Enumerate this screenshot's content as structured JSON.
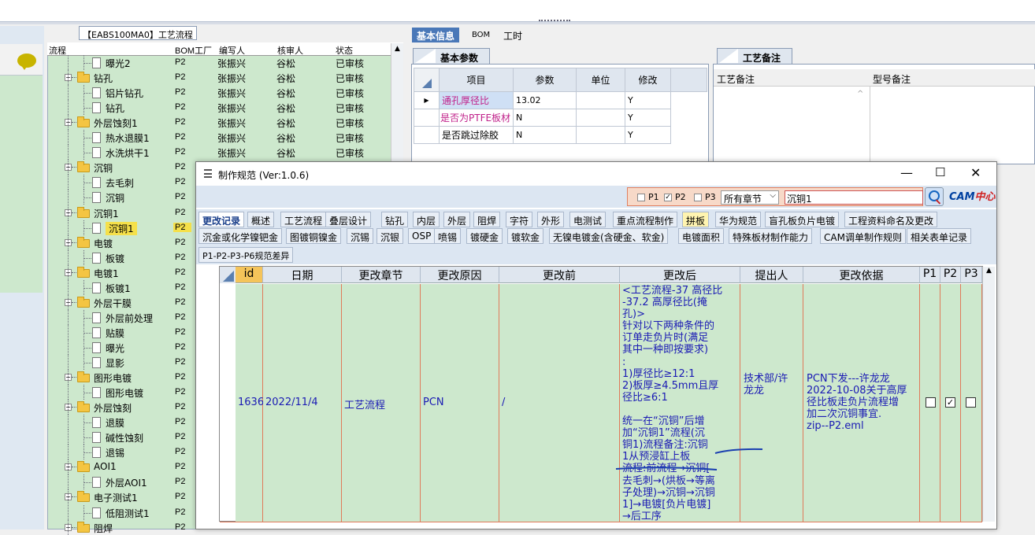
{
  "colors": {
    "green_row": "#cde8cd",
    "selected": "#f5e04a",
    "tab_active": "#4a78b8",
    "annotation": "#1a1ab4"
  },
  "tree_panel": {
    "tab_title": "【EABS100MA0】工艺流程",
    "headers": [
      "流程",
      "BOM工厂",
      "编写人",
      "核审人",
      "状态"
    ],
    "rows": [
      {
        "name": "曝光2",
        "level": 2,
        "factory": "P2",
        "writer": "张振兴",
        "checker": "谷松",
        "status": "已审核"
      },
      {
        "name": "钻孔",
        "level": 1,
        "factory": "P2",
        "writer": "张振兴",
        "checker": "谷松",
        "status": "已审核"
      },
      {
        "name": "铝片钻孔",
        "level": 2,
        "factory": "P2",
        "writer": "张振兴",
        "checker": "谷松",
        "status": "已审核"
      },
      {
        "name": "钻孔",
        "level": 2,
        "factory": "P2",
        "writer": "张振兴",
        "checker": "谷松",
        "status": "已审核"
      },
      {
        "name": "外层蚀刻1",
        "level": 1,
        "factory": "P2",
        "writer": "张振兴",
        "checker": "谷松",
        "status": "已审核"
      },
      {
        "name": "热水退膜1",
        "level": 2,
        "factory": "P2",
        "writer": "张振兴",
        "checker": "谷松",
        "status": "已审核"
      },
      {
        "name": "水洗烘干1",
        "level": 2,
        "factory": "P2",
        "writer": "张振兴",
        "checker": "谷松",
        "status": "已审核"
      },
      {
        "name": "沉铜",
        "level": 1,
        "factory": "P2",
        "writer": "",
        "checker": "",
        "status": ""
      },
      {
        "name": "去毛刺",
        "level": 2,
        "factory": "P2",
        "writer": "",
        "checker": "",
        "status": ""
      },
      {
        "name": "沉铜",
        "level": 2,
        "factory": "P2",
        "writer": "",
        "checker": "",
        "status": ""
      },
      {
        "name": "沉铜1",
        "level": 1,
        "factory": "P2",
        "writer": "",
        "checker": "",
        "status": ""
      },
      {
        "name": "沉铜1",
        "level": 2,
        "factory": "P2",
        "writer": "",
        "checker": "",
        "status": "",
        "selected": true
      },
      {
        "name": "电镀",
        "level": 1,
        "factory": "P2",
        "writer": "",
        "checker": "",
        "status": ""
      },
      {
        "name": "板镀",
        "level": 2,
        "factory": "P2",
        "writer": "",
        "checker": "",
        "status": ""
      },
      {
        "name": "电镀1",
        "level": 1,
        "factory": "P2",
        "writer": "",
        "checker": "",
        "status": ""
      },
      {
        "name": "板镀1",
        "level": 2,
        "factory": "P2",
        "writer": "",
        "checker": "",
        "status": ""
      },
      {
        "name": "外层干膜",
        "level": 1,
        "factory": "P2",
        "writer": "",
        "checker": "",
        "status": ""
      },
      {
        "name": "外层前处理",
        "level": 2,
        "factory": "P2",
        "writer": "",
        "checker": "",
        "status": ""
      },
      {
        "name": "贴膜",
        "level": 2,
        "factory": "P2",
        "writer": "",
        "checker": "",
        "status": ""
      },
      {
        "name": "曝光",
        "level": 2,
        "factory": "P2",
        "writer": "",
        "checker": "",
        "status": ""
      },
      {
        "name": "显影",
        "level": 2,
        "factory": "P2",
        "writer": "",
        "checker": "",
        "status": ""
      },
      {
        "name": "图形电镀",
        "level": 1,
        "factory": "P2",
        "writer": "",
        "checker": "",
        "status": ""
      },
      {
        "name": "图形电镀",
        "level": 2,
        "factory": "P2",
        "writer": "",
        "checker": "",
        "status": ""
      },
      {
        "name": "外层蚀刻",
        "level": 1,
        "factory": "P2",
        "writer": "",
        "checker": "",
        "status": ""
      },
      {
        "name": "退膜",
        "level": 2,
        "factory": "P2",
        "writer": "",
        "checker": "",
        "status": ""
      },
      {
        "name": "碱性蚀刻",
        "level": 2,
        "factory": "P2",
        "writer": "",
        "checker": "",
        "status": ""
      },
      {
        "name": "退锡",
        "level": 2,
        "factory": "P2",
        "writer": "",
        "checker": "",
        "status": ""
      },
      {
        "name": "AOI1",
        "level": 1,
        "factory": "P2",
        "writer": "",
        "checker": "",
        "status": ""
      },
      {
        "name": "外层AOI1",
        "level": 2,
        "factory": "P2",
        "writer": "",
        "checker": "",
        "status": ""
      },
      {
        "name": "电子测试1",
        "level": 1,
        "factory": "P2",
        "writer": "",
        "checker": "",
        "status": ""
      },
      {
        "name": "低阻测试1",
        "level": 2,
        "factory": "P2",
        "writer": "",
        "checker": "",
        "status": ""
      },
      {
        "name": "阻焊",
        "level": 1,
        "factory": "P2",
        "writer": "",
        "checker": "",
        "status": ""
      }
    ]
  },
  "right_tabs": [
    "基本信息",
    "BOM",
    "工时"
  ],
  "basic": {
    "sub_tab": "基本参数",
    "headers": [
      "项目",
      "参数",
      "单位",
      "修改"
    ],
    "rows": [
      {
        "item": "通孔厚径比",
        "param": "13.02",
        "unit": "",
        "edit": "Y"
      },
      {
        "item": "是否为PTFE板材",
        "param": "N",
        "unit": "",
        "edit": "Y"
      },
      {
        "item": "是否跳过除胶",
        "param": "N",
        "unit": "",
        "edit": "Y"
      }
    ]
  },
  "notes": {
    "sub_tab": "工艺备注",
    "col1": "工艺备注",
    "col2": "型号备注"
  },
  "dialog": {
    "title": "制作规范 (Ver:1.0.6)",
    "min": "—",
    "max": "☐",
    "close": "✕",
    "search": {
      "p1": "P1",
      "p2": "P2",
      "p3": "P3",
      "p1_checked": false,
      "p2_checked": true,
      "p3_checked": false,
      "chapter": "所有章节",
      "query": "沉铜1",
      "logo_a": "CAM",
      "logo_b": "中心"
    },
    "tabs_row1": [
      "更改记录",
      "概述",
      "工艺流程",
      "叠层设计",
      "钻孔",
      "内层",
      "外层",
      "阻焊",
      "字符",
      "外形",
      "电测试",
      "重点流程制作",
      "拼板",
      "华为规范",
      "盲孔板负片电镀",
      "工程资料命名及更改"
    ],
    "tabs_row2": [
      "沉金或化学镍钯金",
      "图镀铜镍金",
      "沉锡",
      "沉银",
      "OSP",
      "喷锡",
      "镀硬金",
      "镀软金",
      "无镍电镀金(含硬金、软金)",
      "电镀面积",
      "特殊板材制作能力",
      "CAM调单制作规则",
      "相关表单记录"
    ],
    "tabs_row3": [
      "P1-P2-P3-P6规范差异"
    ],
    "table": {
      "headers": [
        "id",
        "日期",
        "更改章节",
        "更改原因",
        "更改前",
        "更改后",
        "提出人",
        "更改依据",
        "P1",
        "P2",
        "P3"
      ],
      "row": {
        "id": "1636",
        "date": "2022/11/4",
        "chapter": "工艺流程",
        "reason": "PCN",
        "before": "/",
        "after": "<工艺流程-37 高径比\n-37.2 高厚径比(掩\n孔)>\n针对以下两种条件的\n订单走负片时(满足\n其中一种即按要求)\n:\n1)厚径比≥12:1\n2)板厚≥4.5mm且厚\n径比≥6:1\n\n统一在“沉铜”后增\n加“沉铜1”流程(沉\n铜1)流程备注:沉铜\n1从预浸缸上板\n流程:前流程→沉铜[\n去毛刺→(烘板→等离\n子处理)→沉铜→沉铜\n1]→电镀[负片电镀]\n→后工序",
        "proposer": "技术部/许\n龙龙",
        "basis": "PCN下发---许龙龙\n2022-10-08关于高厚\n径比板走负片流程增\n加二次沉铜事宜.\nzip--P2.eml",
        "p1": "☐",
        "p2": "☑",
        "p3": "☐"
      }
    }
  }
}
